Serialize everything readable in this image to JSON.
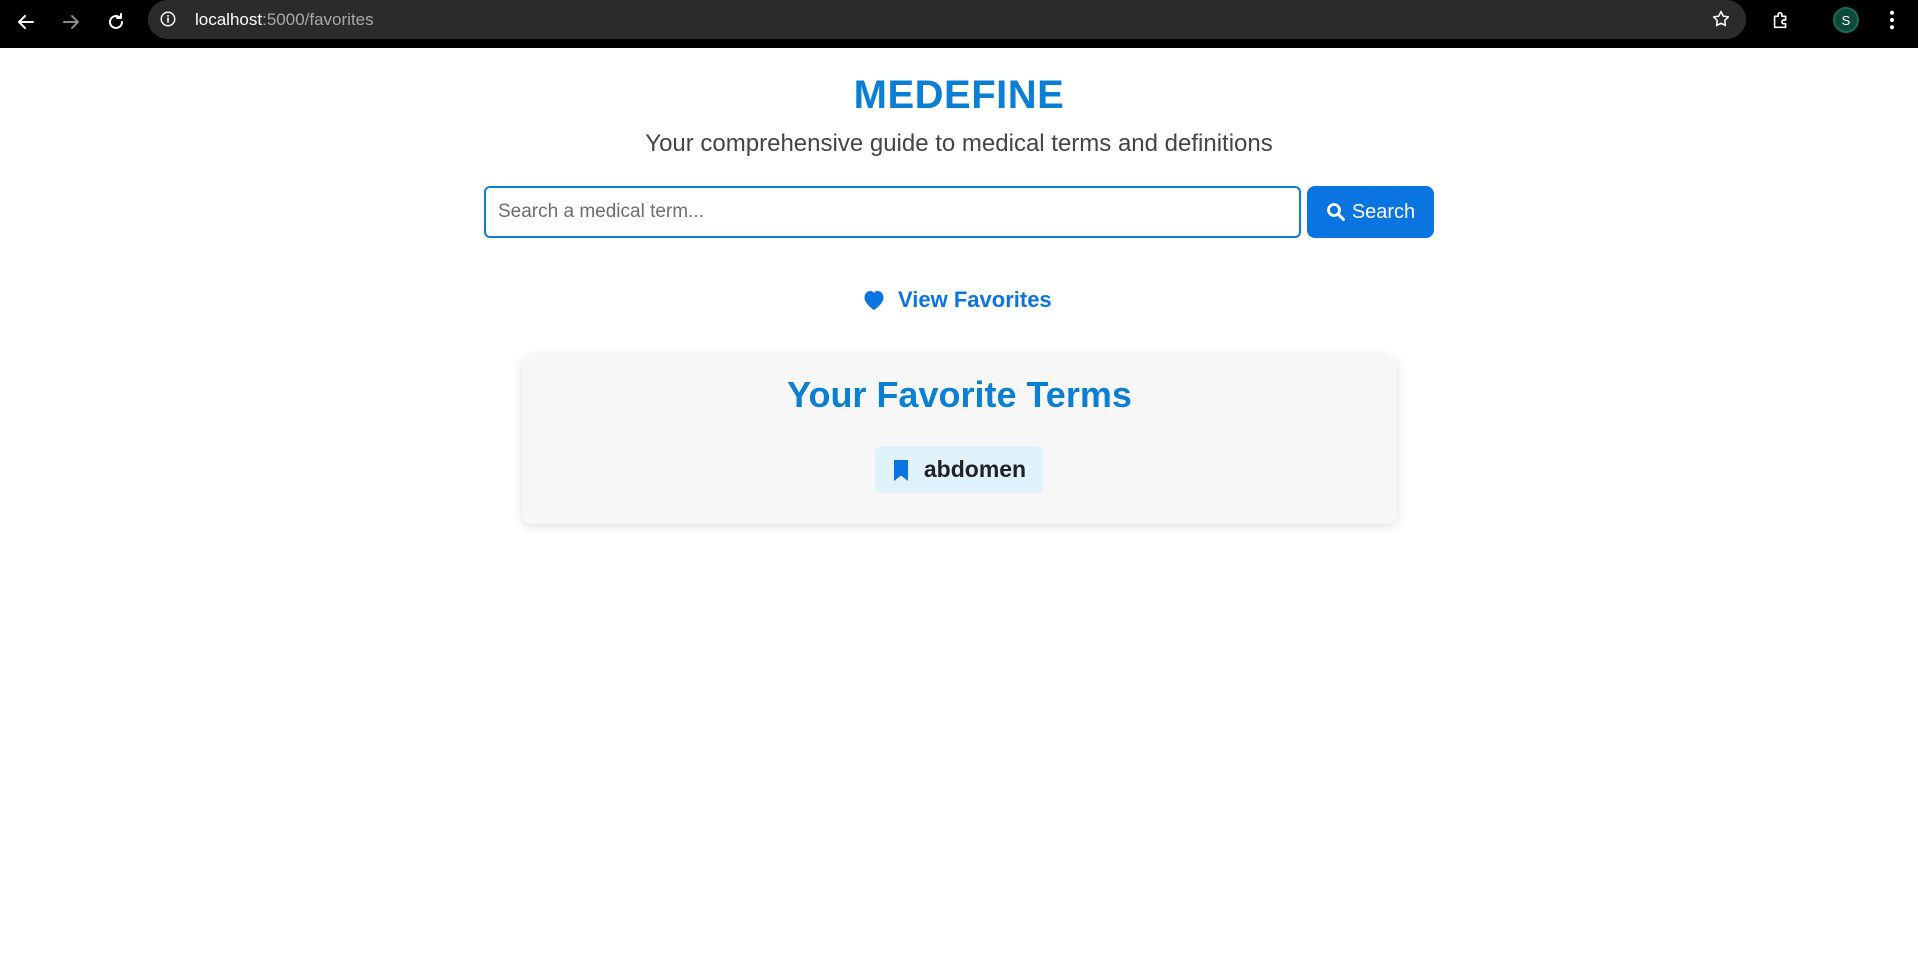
{
  "browser": {
    "url_host": "localhost",
    "url_path": ":5000/favorites",
    "profile_initial": "S"
  },
  "header": {
    "title": "MEDEFINE",
    "subtitle": "Your comprehensive guide to medical terms and definitions"
  },
  "search": {
    "placeholder": "Search a medical term...",
    "value": "",
    "button_label": "Search",
    "button_icon": "search-icon"
  },
  "favorites_link": {
    "label": "View Favorites",
    "icon": "heart-icon"
  },
  "favorites": {
    "title": "Your Favorite Terms",
    "terms": [
      {
        "label": "abdomen",
        "icon": "bookmark-icon"
      }
    ]
  },
  "colors": {
    "brand": "#0a7fd4",
    "button": "#0a74e0",
    "chip_bg": "#e0f3fc",
    "card_bg": "#f7f7f7"
  }
}
